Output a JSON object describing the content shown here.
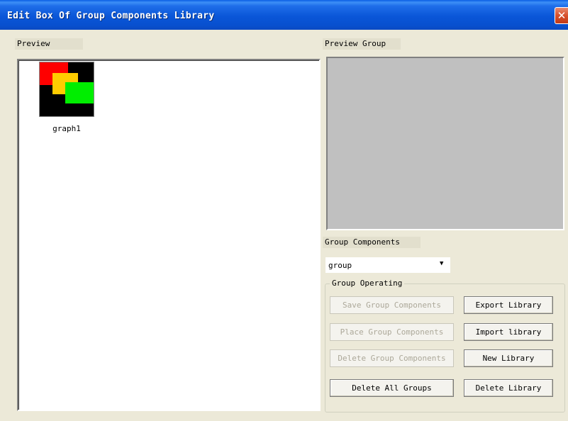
{
  "window": {
    "title": "Edit Box Of Group Components Library",
    "close_glyph": "✕"
  },
  "preview": {
    "label": "Preview",
    "items": [
      {
        "caption": "graph1",
        "colors": [
          "#ff0000",
          "#ffcc00",
          "#00ee00",
          "#000000"
        ]
      }
    ]
  },
  "preview_group": {
    "label": "Preview Group"
  },
  "group_components": {
    "label": "Group Components",
    "selected": "group"
  },
  "group_operating": {
    "legend": "Group Operating",
    "save_label": "Save Group Components",
    "place_label": "Place Group Components",
    "delete_label": "Delete Group Components",
    "delete_all_label": "Delete All Groups",
    "export_label": "Export Library",
    "import_label": "Import library",
    "new_label": "New Library",
    "delete_library_label": "Delete Library"
  }
}
